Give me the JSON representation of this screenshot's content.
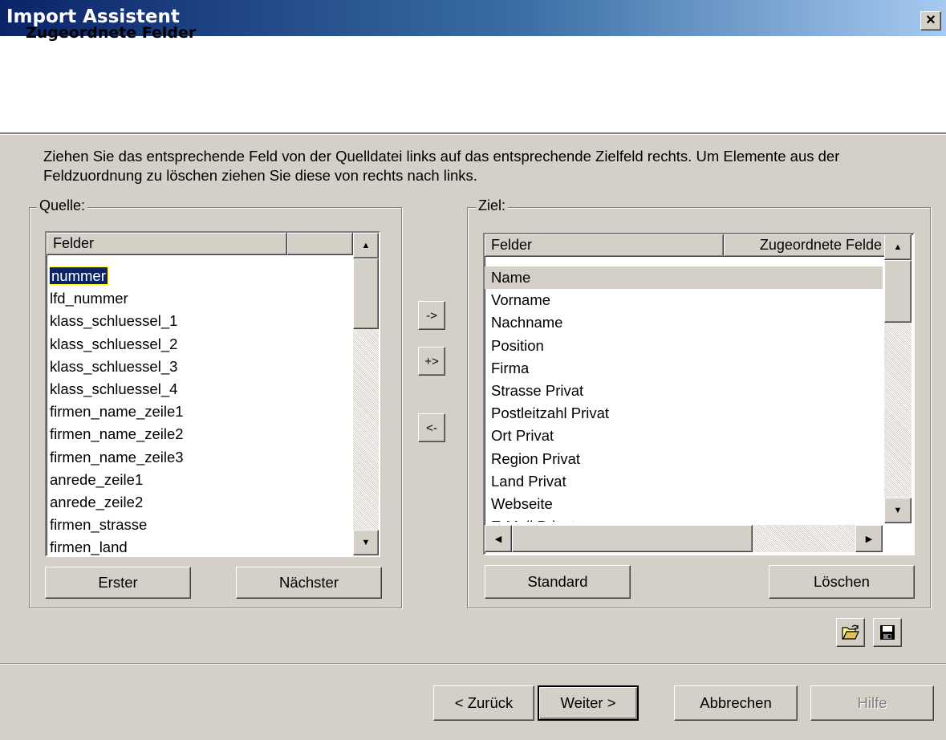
{
  "window": {
    "title": "Import Assistent",
    "close_label": "×"
  },
  "header": {
    "title": "Zugeordnete Felder"
  },
  "instruction": "Ziehen Sie das entsprechende Feld von der Quelldatei links auf das entsprechende Zielfeld rechts. Um Elemente aus der Feldzuordnung zu löschen ziehen Sie diese von rechts nach links.",
  "source": {
    "label": "Quelle:",
    "column_header": "Felder",
    "items": [
      "nummer",
      "lfd_nummer",
      "klass_schluessel_1",
      "klass_schluessel_2",
      "klass_schluessel_3",
      "klass_schluessel_4",
      "firmen_name_zeile1",
      "firmen_name_zeile2",
      "firmen_name_zeile3",
      "anrede_zeile1",
      "anrede_zeile2",
      "firmen_strasse",
      "firmen_land"
    ],
    "selected_index": 0,
    "first_button": "Erster",
    "next_button": "Nächster"
  },
  "transfer_buttons": {
    "assign": "->",
    "add_assign": "+>",
    "remove": "<-"
  },
  "target": {
    "label": "Ziel:",
    "columns": [
      "Felder",
      "Zugeordnete Felde"
    ],
    "items": [
      "Name",
      "Vorname",
      "Nachname",
      "Position",
      "Firma",
      "Strasse Privat",
      "Postleitzahl Privat",
      "Ort Privat",
      "Region Privat",
      "Land Privat",
      "Webseite",
      "E-Mail Privat"
    ],
    "highlighted_index": 0,
    "standard_button": "Standard",
    "delete_button": "Löschen"
  },
  "icons": {
    "open": "open-folder-icon",
    "save": "floppy-disk-icon"
  },
  "footer": {
    "back": "< Zurück",
    "next": "Weiter >",
    "cancel": "Abbrechen",
    "help": "Hilfe"
  },
  "colors": {
    "title_gradient_start": "#0a246a",
    "title_gradient_end": "#a6caf0",
    "selection": "#0a246a",
    "face": "#d4d0c8"
  }
}
